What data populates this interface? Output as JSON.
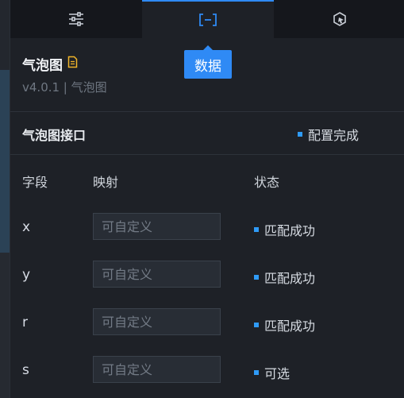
{
  "tabs": [
    {
      "name": "style",
      "icon": "sliders-icon"
    },
    {
      "name": "data",
      "icon": "data-bracket-icon"
    },
    {
      "name": "interaction",
      "icon": "interaction-hexagon-icon"
    }
  ],
  "tooltip": "数据",
  "component": {
    "title": "气泡图",
    "version": "v4.0.1 | 气泡图"
  },
  "api": {
    "section_title": "气泡图接口",
    "status": "配置完成",
    "status_color": "#2f9bf7"
  },
  "table": {
    "headers": [
      "字段",
      "映射",
      "状态"
    ],
    "rows": [
      {
        "field": "x",
        "placeholder": "可自定义",
        "status": "匹配成功"
      },
      {
        "field": "y",
        "placeholder": "可自定义",
        "status": "匹配成功"
      },
      {
        "field": "r",
        "placeholder": "可自定义",
        "status": "匹配成功"
      },
      {
        "field": "s",
        "placeholder": "可自定义",
        "status": "可选"
      }
    ]
  },
  "colors": {
    "accent": "#2f8af5",
    "doc_icon": "#f0b429"
  }
}
